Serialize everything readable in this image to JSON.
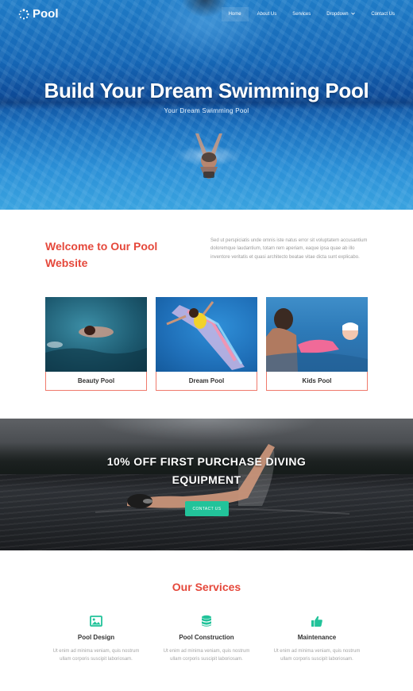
{
  "brand": {
    "name": "Pool",
    "accent_color": "#e5483b",
    "button_color": "#22c39a",
    "card_border_color": "#f07a6c"
  },
  "nav": {
    "items": [
      {
        "label": "Home",
        "active": true
      },
      {
        "label": "About Us"
      },
      {
        "label": "Services"
      },
      {
        "label": "Dropdown"
      },
      {
        "label": "Contact Us"
      }
    ]
  },
  "hero": {
    "title": "Build Your Dream Swimming Pool",
    "subtitle": "Your Dream Swimming Pool"
  },
  "welcome": {
    "title": "Welcome to Our Pool Website",
    "text": "Sed ut perspiciatis unde omnis iste natus error sit voluptatem accusantium doloremque laudantium, totam rem aperiam, eaque ipsa quae ab illo inventore veritatis et quasi architecto beatae vitae dicta sunt explicabo."
  },
  "cards": [
    {
      "label": "Beauty Pool"
    },
    {
      "label": "Dream Pool"
    },
    {
      "label": "Kids Pool"
    }
  ],
  "promo": {
    "title": "10% OFF FIRST PURCHASE DIVING EQUIPMENT",
    "button": "CONTACT US"
  },
  "services": {
    "title": "Our Services",
    "items": [
      {
        "name": "Pool Design",
        "icon": "image-icon",
        "text": "Ut enim ad minima veniam, quis nostrum ullam corporis suscipit laboriosam."
      },
      {
        "name": "Pool Construction",
        "icon": "database-icon",
        "text": "Ut enim ad minima veniam, quis nostrum ullam corporis suscipit laboriosam."
      },
      {
        "name": "Maintenance",
        "icon": "thumbs-up-icon",
        "text": "Ut enim ad minima veniam, quis nostrum ullam corporis suscipit laboriosam."
      }
    ]
  }
}
